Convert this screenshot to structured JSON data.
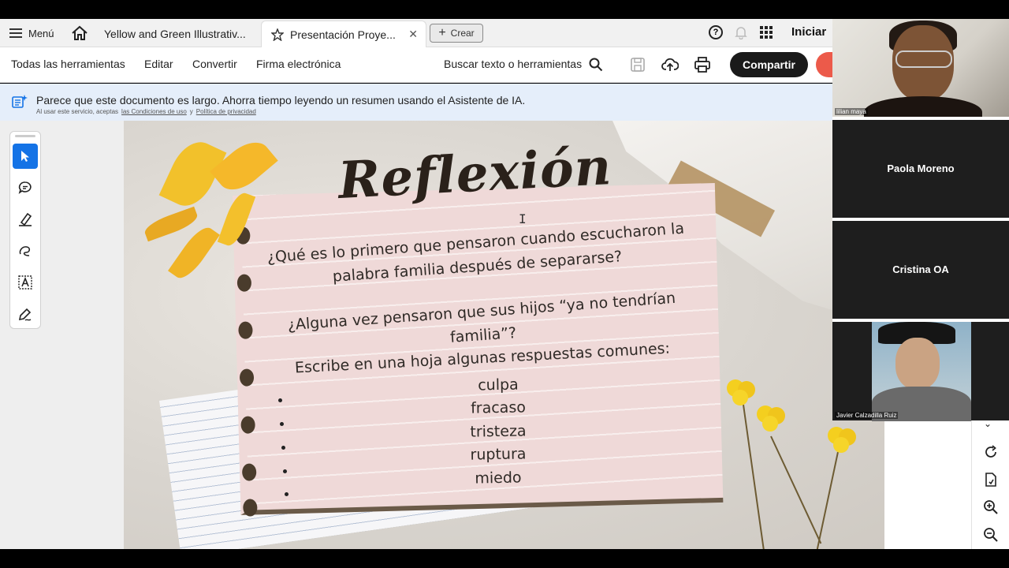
{
  "browser": {
    "menu_label": "Menú",
    "tabs": [
      {
        "label": "Yellow and Green Illustrativ..."
      },
      {
        "label": "Presentación Proye..."
      }
    ],
    "create_label": "Crear",
    "signin_label": "Iniciar"
  },
  "toolbar": {
    "all_tools": "Todas las herramientas",
    "edit": "Editar",
    "convert": "Convertir",
    "esign": "Firma electrónica",
    "search": "Buscar texto o herramientas",
    "share": "Compartir"
  },
  "ai_banner": {
    "message": "Parece que este documento es largo. Ahorra tiempo leyendo un resumen usando el Asistente de IA.",
    "sub_prefix": "Al usar este servicio, aceptas",
    "terms_link": "las Condiciones de uso",
    "sub_and": "y",
    "privacy_link": "Política de privacidad"
  },
  "slide": {
    "title": "Reflexión",
    "question1": "¿Qué es lo primero que pensaron cuando escucharon la palabra familia después de separarse?",
    "question2": "¿Alguna vez pensaron que sus hijos “ya no tendrían familia”?",
    "instruction": "Escribe en una hoja  algunas respuestas comunes:",
    "answers": [
      "culpa",
      "fracaso",
      "tristeza",
      "ruptura",
      "miedo"
    ]
  },
  "participants": [
    {
      "label": "lilian maya",
      "video": true
    },
    {
      "label": "Paola Moreno",
      "video": false
    },
    {
      "label": "Cristina OA",
      "video": false
    },
    {
      "label": "Javier Calzadilla Ruiz",
      "video": true
    }
  ],
  "colors": {
    "accent": "#1473e6",
    "share_button": "#1a1a1a",
    "banner": "#e5eefa",
    "pink_paper": "#efd9d8"
  }
}
